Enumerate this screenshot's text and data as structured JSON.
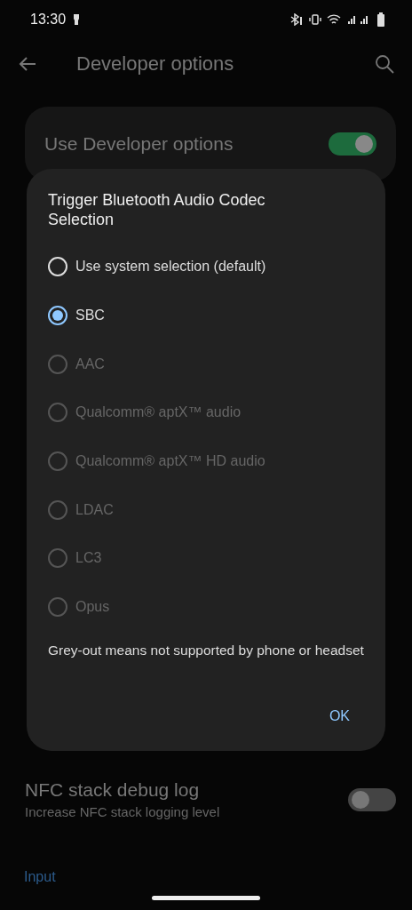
{
  "status_bar": {
    "time": "13:30"
  },
  "app_bar": {
    "title": "Developer options"
  },
  "master_switch": {
    "label": "Use Developer options",
    "on": true
  },
  "settings": [
    {
      "title": "NFC stack debug log",
      "summary": "Increase NFC stack logging level",
      "on": false
    }
  ],
  "section_header": "Input",
  "dialog": {
    "title": "Trigger Bluetooth Audio Codec Selection",
    "options": [
      {
        "label": "Use system selection (default)",
        "selected": false,
        "disabled": false
      },
      {
        "label": "SBC",
        "selected": true,
        "disabled": false
      },
      {
        "label": "AAC",
        "selected": false,
        "disabled": true
      },
      {
        "label": "Qualcomm® aptX™ audio",
        "selected": false,
        "disabled": true
      },
      {
        "label": "Qualcomm® aptX™ HD audio",
        "selected": false,
        "disabled": true
      },
      {
        "label": "LDAC",
        "selected": false,
        "disabled": true
      },
      {
        "label": "LC3",
        "selected": false,
        "disabled": true
      },
      {
        "label": "Opus",
        "selected": false,
        "disabled": true
      }
    ],
    "note": "Grey-out means not supported by phone or headset",
    "button": "OK"
  }
}
